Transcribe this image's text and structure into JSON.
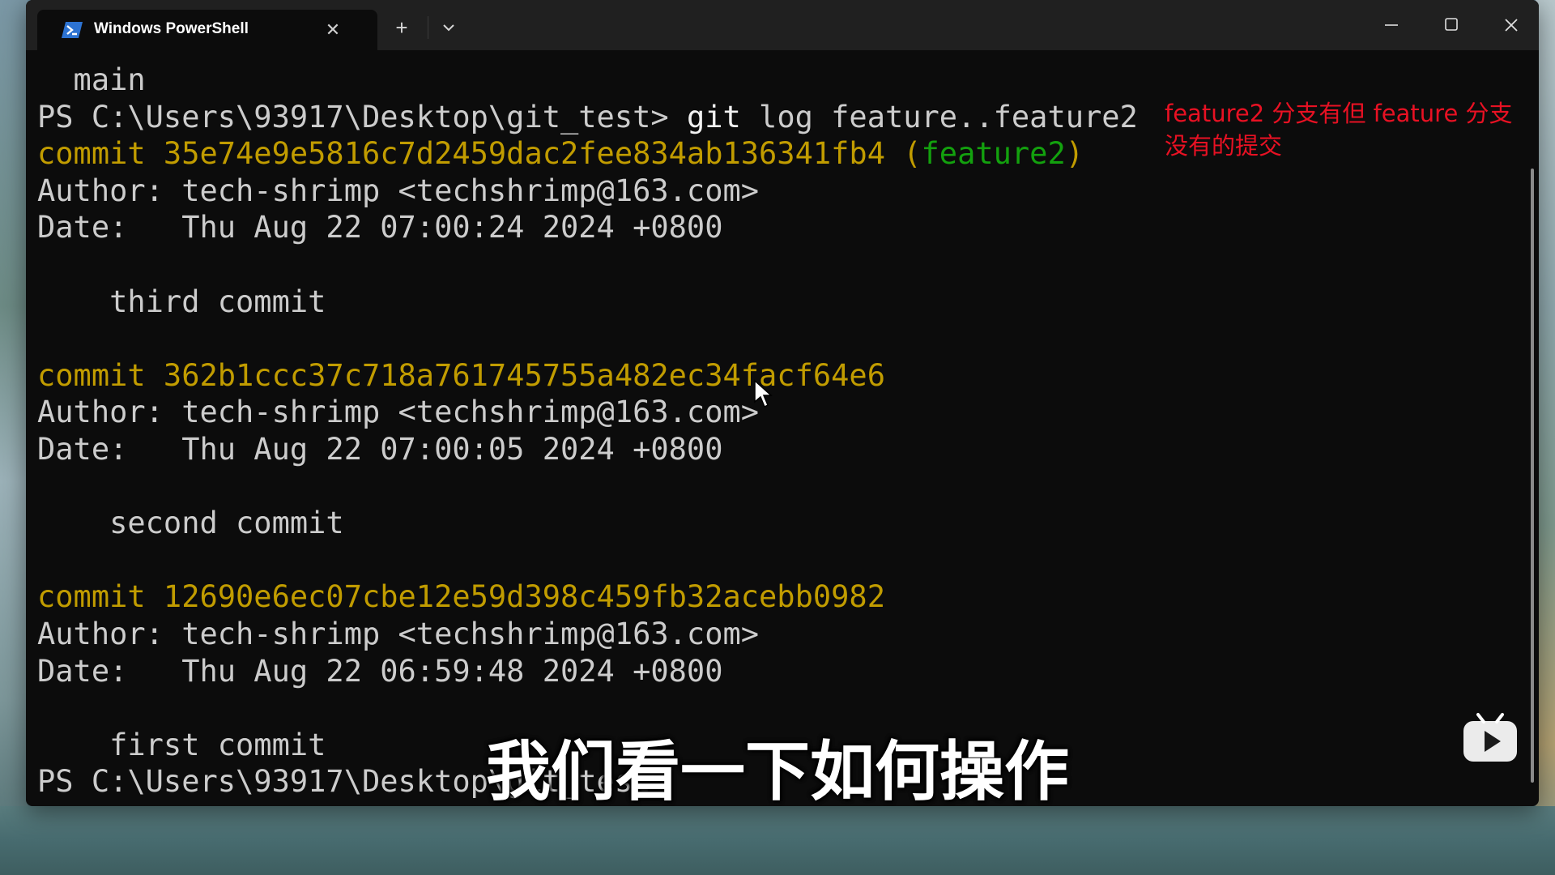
{
  "window": {
    "tab_title": "Windows PowerShell",
    "tab_close": "✕",
    "new_tab": "+",
    "icons": [
      "powershell-icon",
      "close-icon",
      "plus-icon",
      "chevron-down-icon",
      "minimize-icon",
      "maximize-icon",
      "close-icon"
    ]
  },
  "terminal": {
    "lines": [
      {
        "text_plain": "  main"
      },
      {
        "prompt": "PS C:\\Users\\93917\\Desktop\\git_test> ",
        "cmd": "git",
        "args": " log feature..feature2"
      },
      {
        "commit_label": "commit 35e74e9e5816c7d2459dac2fee834ab136341fb4 ",
        "ref": "(feature2)"
      },
      {
        "text_plain": "Author: tech-shrimp <techshrimp@163.com>"
      },
      {
        "text_plain": "Date:   Thu Aug 22 07:00:24 2024 +0800"
      },
      {
        "text_plain": ""
      },
      {
        "text_plain": "    third commit"
      },
      {
        "text_plain": ""
      },
      {
        "commit_label": "commit 362b1ccc37c718a761745755a482ec34facf64e6",
        "ref": ""
      },
      {
        "text_plain": "Author: tech-shrimp <techshrimp@163.com>"
      },
      {
        "text_plain": "Date:   Thu Aug 22 07:00:05 2024 +0800"
      },
      {
        "text_plain": ""
      },
      {
        "text_plain": "    second commit"
      },
      {
        "text_plain": ""
      },
      {
        "commit_label": "commit 12690e6ec07cbe12e59d398c459fb32acebb0982",
        "ref": ""
      },
      {
        "text_plain": "Author: tech-shrimp <techshrimp@163.com>"
      },
      {
        "text_plain": "Date:   Thu Aug 22 06:59:48 2024 +0800"
      },
      {
        "text_plain": ""
      },
      {
        "text_plain": "    first commit"
      },
      {
        "text_plain": "PS C:\\Users\\93917\\Desktop\\git_test>"
      }
    ]
  },
  "annotation": {
    "line1": "feature2 分支有但 feature 分支",
    "line2": "没有的提交"
  },
  "subtitle": "我们看一下如何操作",
  "colors": {
    "commit_yellow": "#c19c00",
    "branch_green": "#13a10e",
    "annotation_red": "#e81123",
    "terminal_bg": "#0c0c0c"
  }
}
